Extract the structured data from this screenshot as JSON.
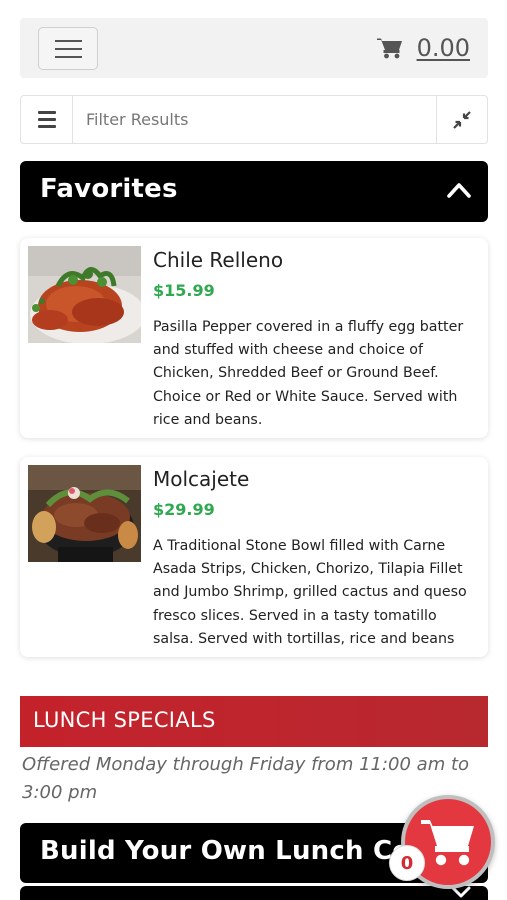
{
  "header": {
    "cart_total": "0.00"
  },
  "filter": {
    "placeholder": "Filter Results"
  },
  "favorites": {
    "title": "Favorites",
    "items": [
      {
        "name": "Chile Relleno",
        "price": "$15.99",
        "description": "Pasilla Pepper covered in a fluffy egg batter and stuffed with cheese and choice of Chicken, Shredded Beef or Ground Beef. Choice or Red or White Sauce. Served with rice and beans."
      },
      {
        "name": "Molcajete",
        "price": "$29.99",
        "description": "A Traditional Stone Bowl filled with Carne Asada Strips, Chicken, Chorizo, Tilapia Fillet and Jumbo Shrimp, grilled cactus and queso fresco slices. Served in a tasty tomatillo salsa. Served with tortillas, rice and beans"
      }
    ]
  },
  "lunch_specials": {
    "banner": "LUNCH SPECIALS",
    "note": "Offered Monday through Friday from 11:00 am to 3:00 pm",
    "subsection_title": "Build Your Own Lunch Co"
  },
  "floating_cart": {
    "count": "0"
  },
  "colors": {
    "price_green": "#2fa84f",
    "lunch_red": "#c4222b",
    "fab_red": "#e3383f",
    "header_black": "#000000"
  }
}
